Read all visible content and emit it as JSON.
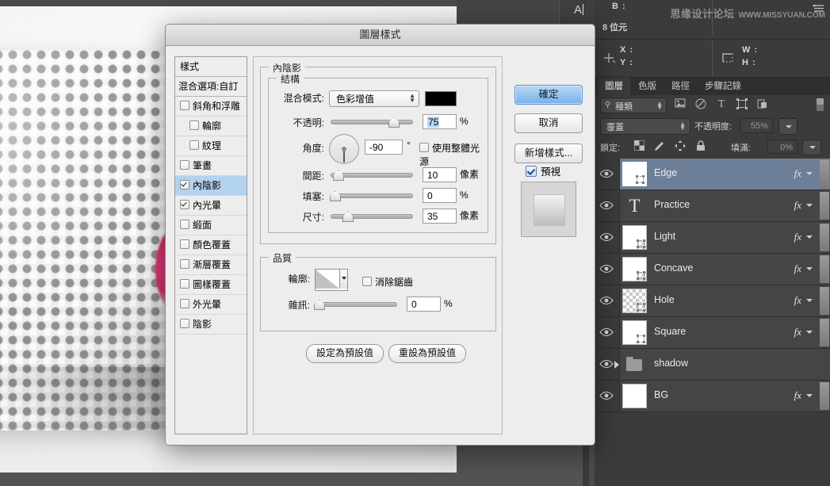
{
  "app": {
    "info": {
      "b_label": "B :",
      "bit_depth": "8 位元",
      "x_label": "X :",
      "y_label": "Y :",
      "w_label": "W :",
      "h_label": "H :",
      "watermark": "思缘设计论坛",
      "watermark_url": "WWW.MISSYUAN.COM"
    },
    "text_cursor": "A"
  },
  "layers_panel": {
    "tabs": [
      {
        "label": "圖層",
        "active": true
      },
      {
        "label": "色版",
        "active": false
      },
      {
        "label": "路徑",
        "active": false
      },
      {
        "label": "步驟記錄",
        "active": false
      }
    ],
    "menu_icon": "panel-menu-icon",
    "filter": {
      "search_icon": "search-icon",
      "kind_label": "種類",
      "icons": [
        "image-filter-icon",
        "adjustment-filter-icon",
        "type-filter-icon",
        "shape-filter-icon",
        "smartobject-filter-icon"
      ],
      "toggle_icon": "filter-toggle-icon"
    },
    "blend": {
      "mode": "覆蓋",
      "opacity_label": "不透明度:",
      "opacity_value": "55%"
    },
    "lock": {
      "label": "鎖定:",
      "icons": [
        "lock-transparency-icon",
        "lock-image-icon",
        "lock-position-icon",
        "lock-all-icon"
      ],
      "fill_label": "填滿:",
      "fill_value": "0%"
    },
    "layers": [
      {
        "name": "Edge",
        "type": "pixel",
        "selected": true,
        "has_fx": true,
        "visible": true,
        "thumb": "white-shape"
      },
      {
        "name": "Practice",
        "type": "text",
        "selected": false,
        "has_fx": true,
        "visible": true,
        "thumb": "type-T"
      },
      {
        "name": "Light",
        "type": "pixel",
        "selected": false,
        "has_fx": true,
        "visible": true,
        "thumb": "transparent-shape"
      },
      {
        "name": "Concave",
        "type": "pixel",
        "selected": false,
        "has_fx": true,
        "visible": true,
        "thumb": "transparent-shape"
      },
      {
        "name": "Hole",
        "type": "pixel",
        "selected": false,
        "has_fx": true,
        "visible": true,
        "thumb": "checker"
      },
      {
        "name": "Square",
        "type": "pixel",
        "selected": false,
        "has_fx": true,
        "visible": true,
        "thumb": "white-shape"
      },
      {
        "name": "shadow",
        "type": "group",
        "selected": false,
        "has_fx": false,
        "visible": true,
        "thumb": "folder"
      },
      {
        "name": "BG",
        "type": "pixel",
        "selected": false,
        "has_fx": true,
        "visible": true,
        "thumb": "white"
      }
    ]
  },
  "dialog": {
    "title": "圖層樣式",
    "styles_sidebar": {
      "header": "樣式",
      "blending_options": "混合選項:自訂",
      "items": [
        {
          "label": "斜角和浮雕",
          "checked": false,
          "indent": false,
          "selected": false
        },
        {
          "label": "輪廓",
          "checked": false,
          "indent": true,
          "selected": false
        },
        {
          "label": "紋理",
          "checked": false,
          "indent": true,
          "selected": false
        },
        {
          "label": "筆畫",
          "checked": false,
          "indent": false,
          "selected": false
        },
        {
          "label": "內陰影",
          "checked": true,
          "indent": false,
          "selected": true
        },
        {
          "label": "內光暈",
          "checked": true,
          "indent": false,
          "selected": false
        },
        {
          "label": "緞面",
          "checked": false,
          "indent": false,
          "selected": false
        },
        {
          "label": "顏色覆蓋",
          "checked": false,
          "indent": false,
          "selected": false
        },
        {
          "label": "漸層覆蓋",
          "checked": false,
          "indent": false,
          "selected": false
        },
        {
          "label": "圖樣覆蓋",
          "checked": false,
          "indent": false,
          "selected": false
        },
        {
          "label": "外光暈",
          "checked": false,
          "indent": false,
          "selected": false
        },
        {
          "label": "陰影",
          "checked": false,
          "indent": false,
          "selected": false
        }
      ]
    },
    "main": {
      "section_title": "內陰影",
      "structure_legend": "結構",
      "blend_mode_label": "混合模式:",
      "blend_mode_value": "色彩增值",
      "color_swatch": "#000000",
      "opacity_label": "不透明:",
      "opacity_value": "75",
      "opacity_unit": "%",
      "angle_label": "角度:",
      "angle_value": "-90",
      "angle_unit": "°",
      "use_global_light": "使用整體光源",
      "use_global_light_checked": false,
      "distance_label": "間距:",
      "distance_value": "10",
      "distance_unit": "像素",
      "choke_label": "填塞:",
      "choke_value": "0",
      "choke_unit": "%",
      "size_label": "尺寸:",
      "size_value": "35",
      "size_unit": "像素",
      "quality_legend": "品質",
      "contour_label": "輪廓:",
      "antialias_label": "消除鋸齒",
      "antialias_checked": false,
      "noise_label": "雜訊:",
      "noise_value": "0",
      "noise_unit": "%",
      "set_default_button": "設定為預設值",
      "reset_default_button": "重設為預設值"
    },
    "buttons": {
      "ok": "確定",
      "cancel": "取消",
      "new_style": "新增樣式...",
      "preview_label": "預視",
      "preview_checked": true
    }
  }
}
